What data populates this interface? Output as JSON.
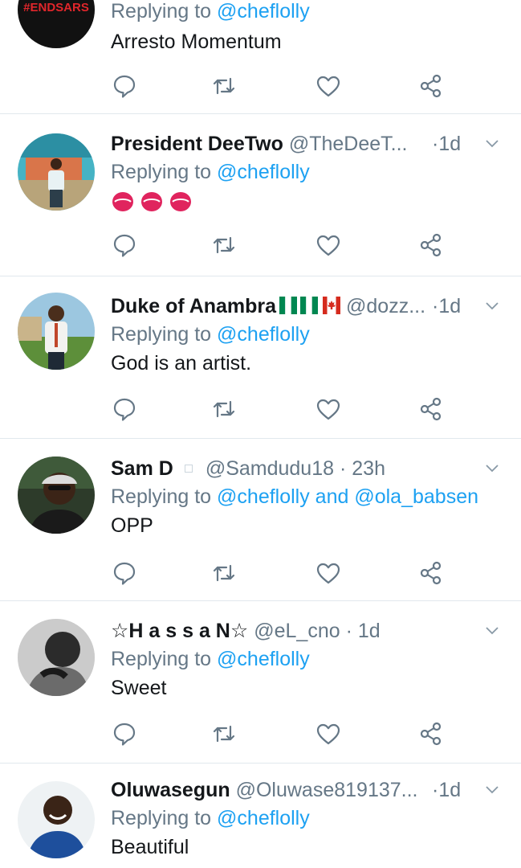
{
  "tweets": [
    {
      "name": "",
      "handle": "",
      "time": "",
      "replying_prefix": "Replying to",
      "replying_link": "@cheflolly",
      "text": "Arresto Momentum",
      "avatar_text": "#ENDSARS"
    },
    {
      "name": "President DeeTwo",
      "handle": "@TheDeeT...",
      "dot": "·",
      "time": "1d",
      "replying_prefix": "Replying to",
      "replying_link": "@cheflolly",
      "text": ""
    },
    {
      "name": "Duke of Anambra",
      "handle": "@dozz...",
      "dot": "·",
      "time": "1d",
      "replying_prefix": "Replying to",
      "replying_link": "@cheflolly",
      "text": "God is an artist."
    },
    {
      "name": "Sam D",
      "handle": "@Samdudu18",
      "dot": "·",
      "time": "23h",
      "replying_prefix": "Replying to",
      "replying_link": "@cheflolly and @ola_babsen",
      "text": "OPP"
    },
    {
      "name": "☆H a s s a N☆",
      "handle": "@eL_cno",
      "dot": "·",
      "time": "1d",
      "replying_prefix": "Replying to",
      "replying_link": "@cheflolly",
      "text": "Sweet"
    },
    {
      "name": "Oluwasegun",
      "handle": "@Oluwase819137...",
      "dot": "·",
      "time": "1d",
      "replying_prefix": "Replying to",
      "replying_link": "@cheflolly",
      "text": "Beautiful"
    }
  ],
  "icons": {
    "reply": "reply-icon",
    "retweet": "retweet-icon",
    "like": "heart-icon",
    "share": "share-icon",
    "menu": "chevron-down-icon"
  },
  "colors": {
    "link": "#1da1f2",
    "secondary": "#657786",
    "divider": "#e1e8ed"
  }
}
